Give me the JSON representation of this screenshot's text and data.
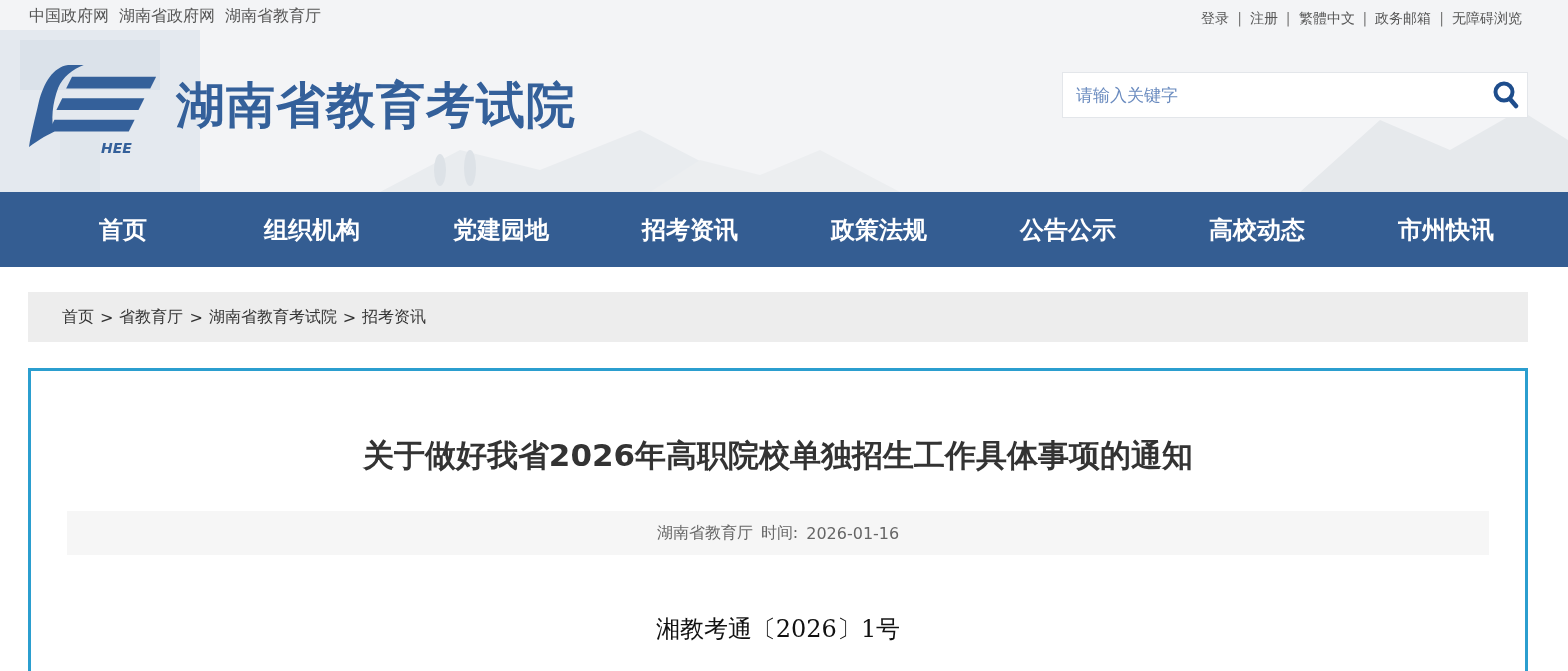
{
  "top_links": [
    "中国政府网",
    "湖南省政府网",
    "湖南省教育厅"
  ],
  "user_links": [
    {
      "label": "登录"
    },
    {
      "label": "注册"
    },
    {
      "label": "繁體中文"
    },
    {
      "label": "政务邮箱"
    },
    {
      "label": "无障碍浏览"
    }
  ],
  "separator": "|",
  "logo": {
    "mark_text": "HEE",
    "site_name": "湖南省教育考试院"
  },
  "search": {
    "placeholder": "请输入关键字"
  },
  "nav": [
    {
      "label": "首页",
      "selected": false
    },
    {
      "label": "组织机构",
      "selected": false
    },
    {
      "label": "党建园地",
      "selected": false
    },
    {
      "label": "招考资讯",
      "selected": false
    },
    {
      "label": "政策法规",
      "selected": false
    },
    {
      "label": "公告公示",
      "selected": false
    },
    {
      "label": "高校动态",
      "selected": false
    },
    {
      "label": "市州快讯",
      "selected": false
    }
  ],
  "breadcrumb": [
    "首页",
    "省教育厅",
    "湖南省教育考试院",
    "招考资讯"
  ],
  "breadcrumb_separator": ">",
  "article": {
    "title": "关于做好我省2026年高职院校单独招生工作具体事项的通知",
    "source": "湖南省教育厅",
    "time_label": "时间:",
    "date": "2026-01-16",
    "doc_number": "湘教考通〔2026〕1号"
  }
}
